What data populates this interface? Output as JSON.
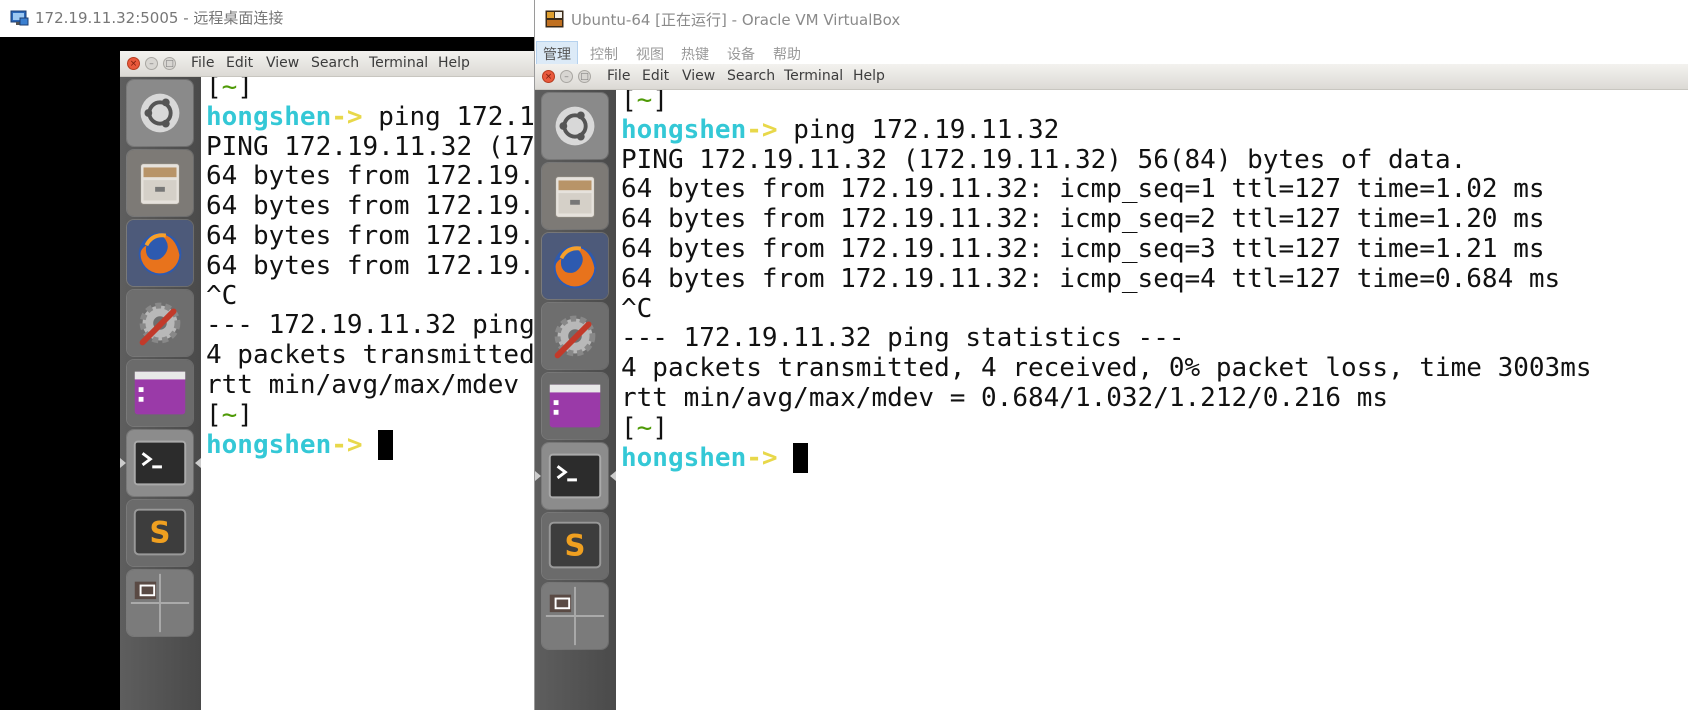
{
  "colors": {
    "prompt_user": "#34c8d6",
    "prompt_arrow": "#e8d84a",
    "bracket": "#4e9a06",
    "launcher_bg": "#555555"
  },
  "rdp": {
    "title": "172.19.11.32:5005 - 远程桌面连接",
    "menu": [
      "File",
      "Edit",
      "View",
      "Search",
      "Terminal",
      "Help"
    ],
    "terminal_lines": [
      {
        "segments": [
          {
            "t": "[",
            "c": "plain"
          },
          {
            "t": "~",
            "c": "green"
          },
          {
            "t": "]",
            "c": "plain"
          }
        ]
      },
      {
        "segments": [
          {
            "t": "hongshen",
            "c": "cyan"
          },
          {
            "t": "->",
            "c": "yellow"
          },
          {
            "t": " ping 172.1",
            "c": "plain"
          }
        ]
      },
      {
        "segments": [
          {
            "t": "PING 172.19.11.32 (17",
            "c": "plain"
          }
        ]
      },
      {
        "segments": [
          {
            "t": "64 bytes from 172.19.",
            "c": "plain"
          }
        ]
      },
      {
        "segments": [
          {
            "t": "64 bytes from 172.19.",
            "c": "plain"
          }
        ]
      },
      {
        "segments": [
          {
            "t": "64 bytes from 172.19.",
            "c": "plain"
          }
        ]
      },
      {
        "segments": [
          {
            "t": "64 bytes from 172.19.",
            "c": "plain"
          }
        ]
      },
      {
        "segments": [
          {
            "t": "^C",
            "c": "plain"
          }
        ]
      },
      {
        "segments": [
          {
            "t": "--- 172.19.11.32 ping",
            "c": "plain"
          }
        ]
      },
      {
        "segments": [
          {
            "t": "4 packets transmitted",
            "c": "plain"
          }
        ]
      },
      {
        "segments": [
          {
            "t": "rtt min/avg/max/mdev ",
            "c": "plain"
          }
        ]
      },
      {
        "segments": [
          {
            "t": "[",
            "c": "plain"
          },
          {
            "t": "~",
            "c": "green"
          },
          {
            "t": "]",
            "c": "plain"
          }
        ]
      },
      {
        "segments": [
          {
            "t": "hongshen",
            "c": "cyan"
          },
          {
            "t": "->",
            "c": "yellow"
          },
          {
            "t": " ",
            "c": "plain"
          }
        ],
        "cursor": true
      }
    ]
  },
  "vbox": {
    "title": "Ubuntu-64 [正在运行] - Oracle VM VirtualBox",
    "host_menu": [
      "管理",
      "控制",
      "视图",
      "热键",
      "设备",
      "帮助"
    ],
    "menu": [
      "File",
      "Edit",
      "View",
      "Search",
      "Terminal",
      "Help"
    ],
    "terminal_lines": [
      {
        "segments": [
          {
            "t": "[",
            "c": "plain"
          },
          {
            "t": "~",
            "c": "green"
          },
          {
            "t": "]",
            "c": "plain"
          }
        ]
      },
      {
        "segments": [
          {
            "t": "hongshen",
            "c": "cyan"
          },
          {
            "t": "->",
            "c": "yellow"
          },
          {
            "t": " ping 172.19.11.32",
            "c": "plain"
          }
        ]
      },
      {
        "segments": [
          {
            "t": "PING 172.19.11.32 (172.19.11.32) 56(84) bytes of data.",
            "c": "plain"
          }
        ]
      },
      {
        "segments": [
          {
            "t": "64 bytes from 172.19.11.32: icmp_seq=1 ttl=127 time=1.02 ms",
            "c": "plain"
          }
        ]
      },
      {
        "segments": [
          {
            "t": "64 bytes from 172.19.11.32: icmp_seq=2 ttl=127 time=1.20 ms",
            "c": "plain"
          }
        ]
      },
      {
        "segments": [
          {
            "t": "64 bytes from 172.19.11.32: icmp_seq=3 ttl=127 time=1.21 ms",
            "c": "plain"
          }
        ]
      },
      {
        "segments": [
          {
            "t": "64 bytes from 172.19.11.32: icmp_seq=4 ttl=127 time=0.684 ms",
            "c": "plain"
          }
        ]
      },
      {
        "segments": [
          {
            "t": "^C",
            "c": "plain"
          }
        ]
      },
      {
        "segments": [
          {
            "t": "--- 172.19.11.32 ping statistics ---",
            "c": "plain"
          }
        ]
      },
      {
        "segments": [
          {
            "t": "4 packets transmitted, 4 received, 0% packet loss, time 3003ms",
            "c": "plain"
          }
        ]
      },
      {
        "segments": [
          {
            "t": "rtt min/avg/max/mdev = 0.684/1.032/1.212/0.216 ms",
            "c": "plain"
          }
        ]
      },
      {
        "segments": [
          {
            "t": "[",
            "c": "plain"
          },
          {
            "t": "~",
            "c": "green"
          },
          {
            "t": "]",
            "c": "plain"
          }
        ]
      },
      {
        "segments": [
          {
            "t": "hongshen",
            "c": "cyan"
          },
          {
            "t": "->",
            "c": "yellow"
          },
          {
            "t": " ",
            "c": "plain"
          }
        ],
        "cursor": true
      }
    ]
  },
  "launcher_icons": [
    "ubuntu-logo-icon",
    "files-icon",
    "firefox-icon",
    "system-settings-icon",
    "software-center-icon",
    "terminal-icon",
    "sublime-text-icon",
    "workspace-switcher-icon"
  ]
}
